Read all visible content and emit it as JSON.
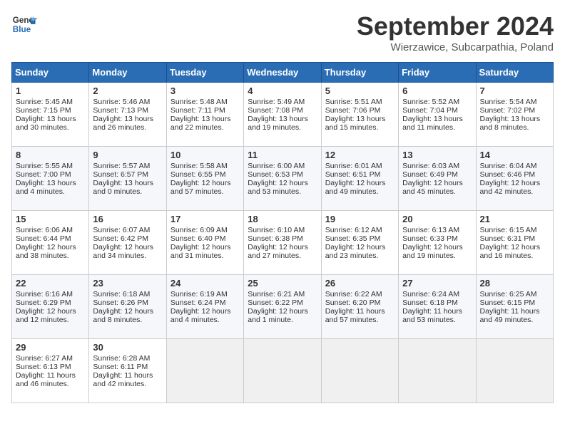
{
  "header": {
    "logo_line1": "General",
    "logo_line2": "Blue",
    "month": "September 2024",
    "location": "Wierzawice, Subcarpathia, Poland"
  },
  "weekdays": [
    "Sunday",
    "Monday",
    "Tuesday",
    "Wednesday",
    "Thursday",
    "Friday",
    "Saturday"
  ],
  "weeks": [
    [
      {
        "day": "1",
        "lines": [
          "Sunrise: 5:45 AM",
          "Sunset: 7:15 PM",
          "Daylight: 13 hours",
          "and 30 minutes."
        ]
      },
      {
        "day": "2",
        "lines": [
          "Sunrise: 5:46 AM",
          "Sunset: 7:13 PM",
          "Daylight: 13 hours",
          "and 26 minutes."
        ]
      },
      {
        "day": "3",
        "lines": [
          "Sunrise: 5:48 AM",
          "Sunset: 7:11 PM",
          "Daylight: 13 hours",
          "and 22 minutes."
        ]
      },
      {
        "day": "4",
        "lines": [
          "Sunrise: 5:49 AM",
          "Sunset: 7:08 PM",
          "Daylight: 13 hours",
          "and 19 minutes."
        ]
      },
      {
        "day": "5",
        "lines": [
          "Sunrise: 5:51 AM",
          "Sunset: 7:06 PM",
          "Daylight: 13 hours",
          "and 15 minutes."
        ]
      },
      {
        "day": "6",
        "lines": [
          "Sunrise: 5:52 AM",
          "Sunset: 7:04 PM",
          "Daylight: 13 hours",
          "and 11 minutes."
        ]
      },
      {
        "day": "7",
        "lines": [
          "Sunrise: 5:54 AM",
          "Sunset: 7:02 PM",
          "Daylight: 13 hours",
          "and 8 minutes."
        ]
      }
    ],
    [
      {
        "day": "8",
        "lines": [
          "Sunrise: 5:55 AM",
          "Sunset: 7:00 PM",
          "Daylight: 13 hours",
          "and 4 minutes."
        ]
      },
      {
        "day": "9",
        "lines": [
          "Sunrise: 5:57 AM",
          "Sunset: 6:57 PM",
          "Daylight: 13 hours",
          "and 0 minutes."
        ]
      },
      {
        "day": "10",
        "lines": [
          "Sunrise: 5:58 AM",
          "Sunset: 6:55 PM",
          "Daylight: 12 hours",
          "and 57 minutes."
        ]
      },
      {
        "day": "11",
        "lines": [
          "Sunrise: 6:00 AM",
          "Sunset: 6:53 PM",
          "Daylight: 12 hours",
          "and 53 minutes."
        ]
      },
      {
        "day": "12",
        "lines": [
          "Sunrise: 6:01 AM",
          "Sunset: 6:51 PM",
          "Daylight: 12 hours",
          "and 49 minutes."
        ]
      },
      {
        "day": "13",
        "lines": [
          "Sunrise: 6:03 AM",
          "Sunset: 6:49 PM",
          "Daylight: 12 hours",
          "and 45 minutes."
        ]
      },
      {
        "day": "14",
        "lines": [
          "Sunrise: 6:04 AM",
          "Sunset: 6:46 PM",
          "Daylight: 12 hours",
          "and 42 minutes."
        ]
      }
    ],
    [
      {
        "day": "15",
        "lines": [
          "Sunrise: 6:06 AM",
          "Sunset: 6:44 PM",
          "Daylight: 12 hours",
          "and 38 minutes."
        ]
      },
      {
        "day": "16",
        "lines": [
          "Sunrise: 6:07 AM",
          "Sunset: 6:42 PM",
          "Daylight: 12 hours",
          "and 34 minutes."
        ]
      },
      {
        "day": "17",
        "lines": [
          "Sunrise: 6:09 AM",
          "Sunset: 6:40 PM",
          "Daylight: 12 hours",
          "and 31 minutes."
        ]
      },
      {
        "day": "18",
        "lines": [
          "Sunrise: 6:10 AM",
          "Sunset: 6:38 PM",
          "Daylight: 12 hours",
          "and 27 minutes."
        ]
      },
      {
        "day": "19",
        "lines": [
          "Sunrise: 6:12 AM",
          "Sunset: 6:35 PM",
          "Daylight: 12 hours",
          "and 23 minutes."
        ]
      },
      {
        "day": "20",
        "lines": [
          "Sunrise: 6:13 AM",
          "Sunset: 6:33 PM",
          "Daylight: 12 hours",
          "and 19 minutes."
        ]
      },
      {
        "day": "21",
        "lines": [
          "Sunrise: 6:15 AM",
          "Sunset: 6:31 PM",
          "Daylight: 12 hours",
          "and 16 minutes."
        ]
      }
    ],
    [
      {
        "day": "22",
        "lines": [
          "Sunrise: 6:16 AM",
          "Sunset: 6:29 PM",
          "Daylight: 12 hours",
          "and 12 minutes."
        ]
      },
      {
        "day": "23",
        "lines": [
          "Sunrise: 6:18 AM",
          "Sunset: 6:26 PM",
          "Daylight: 12 hours",
          "and 8 minutes."
        ]
      },
      {
        "day": "24",
        "lines": [
          "Sunrise: 6:19 AM",
          "Sunset: 6:24 PM",
          "Daylight: 12 hours",
          "and 4 minutes."
        ]
      },
      {
        "day": "25",
        "lines": [
          "Sunrise: 6:21 AM",
          "Sunset: 6:22 PM",
          "Daylight: 12 hours",
          "and 1 minute."
        ]
      },
      {
        "day": "26",
        "lines": [
          "Sunrise: 6:22 AM",
          "Sunset: 6:20 PM",
          "Daylight: 11 hours",
          "and 57 minutes."
        ]
      },
      {
        "day": "27",
        "lines": [
          "Sunrise: 6:24 AM",
          "Sunset: 6:18 PM",
          "Daylight: 11 hours",
          "and 53 minutes."
        ]
      },
      {
        "day": "28",
        "lines": [
          "Sunrise: 6:25 AM",
          "Sunset: 6:15 PM",
          "Daylight: 11 hours",
          "and 49 minutes."
        ]
      }
    ],
    [
      {
        "day": "29",
        "lines": [
          "Sunrise: 6:27 AM",
          "Sunset: 6:13 PM",
          "Daylight: 11 hours",
          "and 46 minutes."
        ]
      },
      {
        "day": "30",
        "lines": [
          "Sunrise: 6:28 AM",
          "Sunset: 6:11 PM",
          "Daylight: 11 hours",
          "and 42 minutes."
        ]
      },
      {
        "day": "",
        "lines": []
      },
      {
        "day": "",
        "lines": []
      },
      {
        "day": "",
        "lines": []
      },
      {
        "day": "",
        "lines": []
      },
      {
        "day": "",
        "lines": []
      }
    ]
  ]
}
